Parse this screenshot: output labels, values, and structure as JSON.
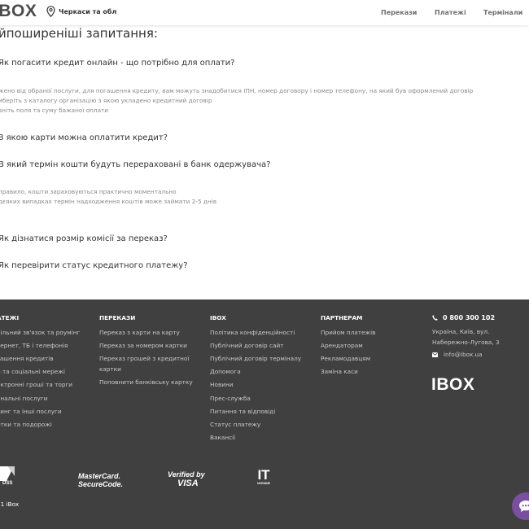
{
  "header": {
    "logo": "IBOX",
    "location": "Черкаси та обл",
    "nav": [
      "Перекази",
      "Платежі",
      "Термінали"
    ]
  },
  "faq": {
    "title": "йпоширеніші запитання:",
    "questions": [
      "Як погасити кредит онлайн - що потрібно для оплати?",
      "З якою карти можна оплатити кредит?",
      "В який термін кошти будуть перераховані в банк одержувача?",
      "Як дізнатися розмір комісії за переказ?",
      "Як перевірити статус кредитного платежу?"
    ],
    "answer1": [
      "жено від обраної послуги, для погашення кредиту, вам можуть знадобитися ІПН, номер договору і номер телефону, на який був оформлений договір",
      "иберіть з каталогу організацію з якою укладено кредитний договір",
      "вніть поля та суму бажаної оплати"
    ],
    "answer3": [
      "правило, кошти зараховуються практично моментально",
      "дєяких випадках термін надходження коштів може займати 2-5 днів"
    ]
  },
  "footer": {
    "columns": [
      {
        "title": "АТЕЖІ",
        "links": [
          "більний зв'язок та роумінг",
          "тернет, ТБ і телефонія",
          "гашення кредитів",
          "и та соціальні мережі",
          "ектронні гроші та торги",
          "унальні послуги",
          "тинг та інші послуги",
          "ртки та подорожі"
        ]
      },
      {
        "title": "ПЕРЕКАЗИ",
        "links": [
          "Переказ з карти на карту",
          "Переказ за номером картки",
          "Переказ грошей з кредитної картки",
          "Поповнити банківську картку"
        ]
      },
      {
        "title": "IBOX",
        "links": [
          "Політика конфіденційності",
          "Публічний договір сайт",
          "Публічний договір терміналу",
          "Допомога",
          "Новини",
          "Прес-служба",
          "Питання та відповіді",
          "Статус платежу",
          "Вакансії"
        ]
      },
      {
        "title": "ПАРТНЕРАМ",
        "links": [
          "Прийом платежів",
          "Арендаторам",
          "Рекламодавцям",
          "Заміна каси"
        ]
      }
    ],
    "contact": {
      "phone": "0 800 300 102",
      "address": "Україна, Київ, вул. Набережно-Лугова, 3",
      "email": "info@ibox.ua"
    },
    "logo": "IBOX",
    "badges": {
      "pci": "DSS",
      "mastercard_line1": "MasterCard.",
      "mastercard_line2": "SecureCode.",
      "visa_line1": "Verified by",
      "visa_line2": "VISA",
      "it_line1": "IT",
      "it_line2": "UKRAINE"
    },
    "copyright": "21 iBox"
  },
  "colors": {
    "footer_bg": "#404040",
    "chat_button": "#7b4fa0"
  }
}
